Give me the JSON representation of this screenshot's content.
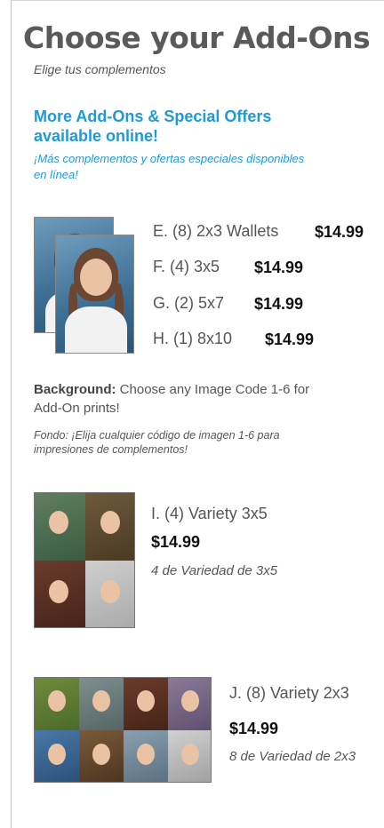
{
  "header": {
    "title": "Choose your Add-Ons",
    "subtitle": "Elige tus complementos"
  },
  "online": {
    "headline": "More Add-Ons & Special Offers available online!",
    "sub": "¡Más complementos y ofertas especiales disponibles en línea!"
  },
  "packages": [
    {
      "label": "E. (8) 2x3 Wallets",
      "price": "$14.99"
    },
    {
      "label": "F. (4) 3x5",
      "price": "$14.99"
    },
    {
      "label": "G. (2) 5x7",
      "price": "$14.99"
    },
    {
      "label": "H. (1) 8x10",
      "price": "$14.99"
    }
  ],
  "background_note": {
    "label": "Background:",
    "text": " Choose any Image Code 1-6 for Add-On prints!",
    "sub": "Fondo: ¡Elija cualquier código de imagen 1-6 para impresiones de complementos!"
  },
  "variety_3x5": {
    "label": "I. (4) Variety 3x5",
    "price": "$14.99",
    "sub": "4 de Variedad de 3x5"
  },
  "variety_2x3": {
    "label": "J. (8) Variety 2x3",
    "price": "$14.99",
    "sub": "8 de Variedad de 2x3"
  },
  "colors": {
    "accent": "#1e9ad6",
    "text": "#555555",
    "price": "#111111"
  }
}
